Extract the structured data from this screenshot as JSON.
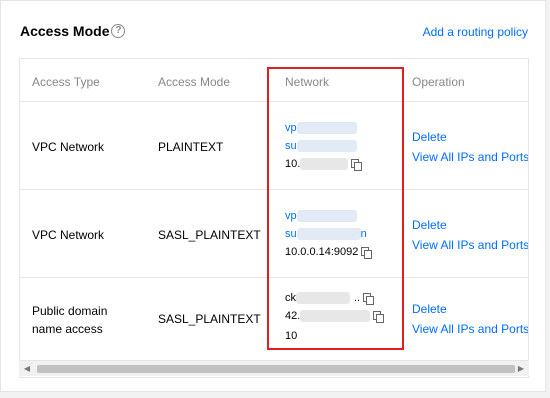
{
  "header": {
    "title": "Access Mode",
    "help_icon": "?",
    "add_link": "Add a routing policy"
  },
  "table": {
    "columns": [
      "Access Type",
      "Access Mode",
      "Network",
      "Operation"
    ],
    "rows": [
      {
        "access_type": "VPC Network",
        "access_mode": "PLAINTEXT",
        "network": [
          "vp",
          "su",
          "10."
        ],
        "actions": [
          "Delete",
          "View All IPs and Ports"
        ]
      },
      {
        "access_type": "VPC Network",
        "access_mode": "SASL_PLAINTEXT",
        "network": [
          "vp",
          "su",
          "n",
          "10.0.0.14:9092"
        ],
        "actions": [
          "Delete",
          "View All IPs and Ports"
        ]
      },
      {
        "access_type_line1": "Public domain",
        "access_type_line2": "name access",
        "access_mode": "SASL_PLAINTEXT",
        "network": [
          "ck",
          "..",
          "42.",
          "10"
        ],
        "actions": [
          "Delete",
          "View All IPs and Ports"
        ]
      }
    ]
  },
  "icons": [
    "help-icon",
    "copy-icon",
    "scroll-left-icon",
    "scroll-right-icon"
  ],
  "colors": {
    "link": "#006eff",
    "highlight": "#e02020",
    "header_text": "#888888"
  }
}
